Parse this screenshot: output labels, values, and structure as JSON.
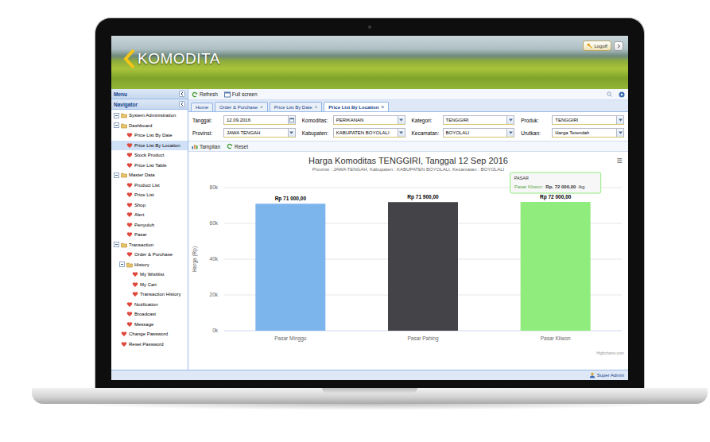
{
  "header": {
    "logo": "KOMODITA",
    "logoff": "Logoff"
  },
  "sidebar": {
    "menu_title": "Menu",
    "navigator_title": "Navigator",
    "items": [
      {
        "label": "System Administration",
        "kind": "group",
        "depth": 0,
        "expanded": true,
        "selected": false
      },
      {
        "label": "Dashboard",
        "kind": "group",
        "depth": 0,
        "expanded": true,
        "selected": false
      },
      {
        "label": "Price List By Date",
        "kind": "leaf",
        "depth": 1,
        "expanded": false,
        "selected": false
      },
      {
        "label": "Price List By Location",
        "kind": "leaf",
        "depth": 1,
        "expanded": false,
        "selected": true
      },
      {
        "label": "Stock Product",
        "kind": "leaf",
        "depth": 1,
        "expanded": false,
        "selected": false
      },
      {
        "label": "Price List Table",
        "kind": "leaf",
        "depth": 1,
        "expanded": false,
        "selected": false
      },
      {
        "label": "Master Data",
        "kind": "group",
        "depth": 0,
        "expanded": true,
        "selected": false
      },
      {
        "label": "Product List",
        "kind": "leaf",
        "depth": 1,
        "expanded": false,
        "selected": false
      },
      {
        "label": "Price List",
        "kind": "leaf",
        "depth": 1,
        "expanded": false,
        "selected": false
      },
      {
        "label": "Shop",
        "kind": "leaf",
        "depth": 1,
        "expanded": false,
        "selected": false
      },
      {
        "label": "Alert",
        "kind": "leaf",
        "depth": 1,
        "expanded": false,
        "selected": false
      },
      {
        "label": "Penyuluh",
        "kind": "leaf",
        "depth": 1,
        "expanded": false,
        "selected": false
      },
      {
        "label": "Pasar",
        "kind": "leaf",
        "depth": 1,
        "expanded": false,
        "selected": false
      },
      {
        "label": "Transaction",
        "kind": "group",
        "depth": 0,
        "expanded": true,
        "selected": false
      },
      {
        "label": "Order & Purchase",
        "kind": "leaf",
        "depth": 1,
        "expanded": false,
        "selected": false
      },
      {
        "label": "History",
        "kind": "group",
        "depth": 1,
        "expanded": true,
        "selected": false
      },
      {
        "label": "My Wishlist",
        "kind": "leaf",
        "depth": 2,
        "expanded": false,
        "selected": false
      },
      {
        "label": "My Cart",
        "kind": "leaf",
        "depth": 2,
        "expanded": false,
        "selected": false
      },
      {
        "label": "Transaction History",
        "kind": "leaf",
        "depth": 2,
        "expanded": false,
        "selected": false
      },
      {
        "label": "Notification",
        "kind": "leaf",
        "depth": 1,
        "expanded": false,
        "selected": false
      },
      {
        "label": "Broadcast",
        "kind": "leaf",
        "depth": 1,
        "expanded": false,
        "selected": false
      },
      {
        "label": "Message",
        "kind": "leaf",
        "depth": 1,
        "expanded": false,
        "selected": false
      },
      {
        "label": "Change Password",
        "kind": "leaf",
        "depth": 0,
        "expanded": false,
        "selected": false
      },
      {
        "label": "Reset Password",
        "kind": "leaf",
        "depth": 0,
        "expanded": false,
        "selected": false
      }
    ]
  },
  "toolbar": [
    "Refresh",
    "Full screen"
  ],
  "tabs": {
    "close": "×",
    "items": [
      {
        "label": "Home",
        "closable": false,
        "selected": false
      },
      {
        "label": "Order & Purchase",
        "closable": true,
        "selected": false
      },
      {
        "label": "Price List By Date",
        "closable": true,
        "selected": false
      },
      {
        "label": "Price List By Location",
        "closable": true,
        "selected": true
      }
    ]
  },
  "form": {
    "rows": [
      [
        {
          "label": "Tanggal:",
          "value": "12.09.2016",
          "kind": "date"
        },
        {
          "label": "Komoditas:",
          "value": "PERIKANAN",
          "kind": "select"
        },
        {
          "label": "Kategori:",
          "value": "TENGGIRI",
          "kind": "select"
        },
        {
          "label": "Produk:",
          "value": "TENGGIRI",
          "kind": "select"
        }
      ],
      [
        {
          "label": "Provinsi:",
          "value": "JAWA TENGAH",
          "kind": "select"
        },
        {
          "label": "Kabupaten:",
          "value": "KABUPATEN BOYOLALI",
          "kind": "select"
        },
        {
          "label": "Kecamatan:",
          "value": "BOYOLALI",
          "kind": "select"
        },
        {
          "label": "Urutkan:",
          "value": "Harga Terendah",
          "kind": "select"
        }
      ]
    ]
  },
  "actions": [
    "Tampilan",
    "Reset"
  ],
  "chart": {
    "title": "Harga Komoditas TENGGIRI, Tanggal 12 Sep 2016",
    "subtitle": "Provinsi : JAWA TENGAH, Kabupaten : KABUPATEN BOYOLALI, Kecamatan : BOYOLALI",
    "menu": "≡",
    "y_axis_title": "Harga (Rp)",
    "ticks": [
      {
        "label": "0k",
        "value": 0
      },
      {
        "label": "20k",
        "value": 20000
      },
      {
        "label": "40k",
        "value": 40000
      },
      {
        "label": "60k",
        "value": 60000
      },
      {
        "label": "80k",
        "value": 80000
      }
    ],
    "categories": [
      "Pasar Minggu",
      "Pasar Pahing",
      "Pasar Kliwon"
    ],
    "series": [
      {
        "name": "Harga",
        "values": [
          71000,
          71900,
          72000
        ],
        "colors": [
          "#7cb5ec",
          "#434348",
          "#90ed7d"
        ],
        "data_labels": [
          "Rp 71 000,00",
          "Rp 71 900,00",
          "Rp 72 000,00"
        ]
      }
    ],
    "tooltip": {
      "title": "PASAR",
      "label": "Pasar Kliwon:",
      "value": "Rp. 72 000,00",
      "unit": "/kg"
    },
    "credit": "Highcharts.com"
  },
  "status_bar": {
    "user": "Super Admin"
  }
}
